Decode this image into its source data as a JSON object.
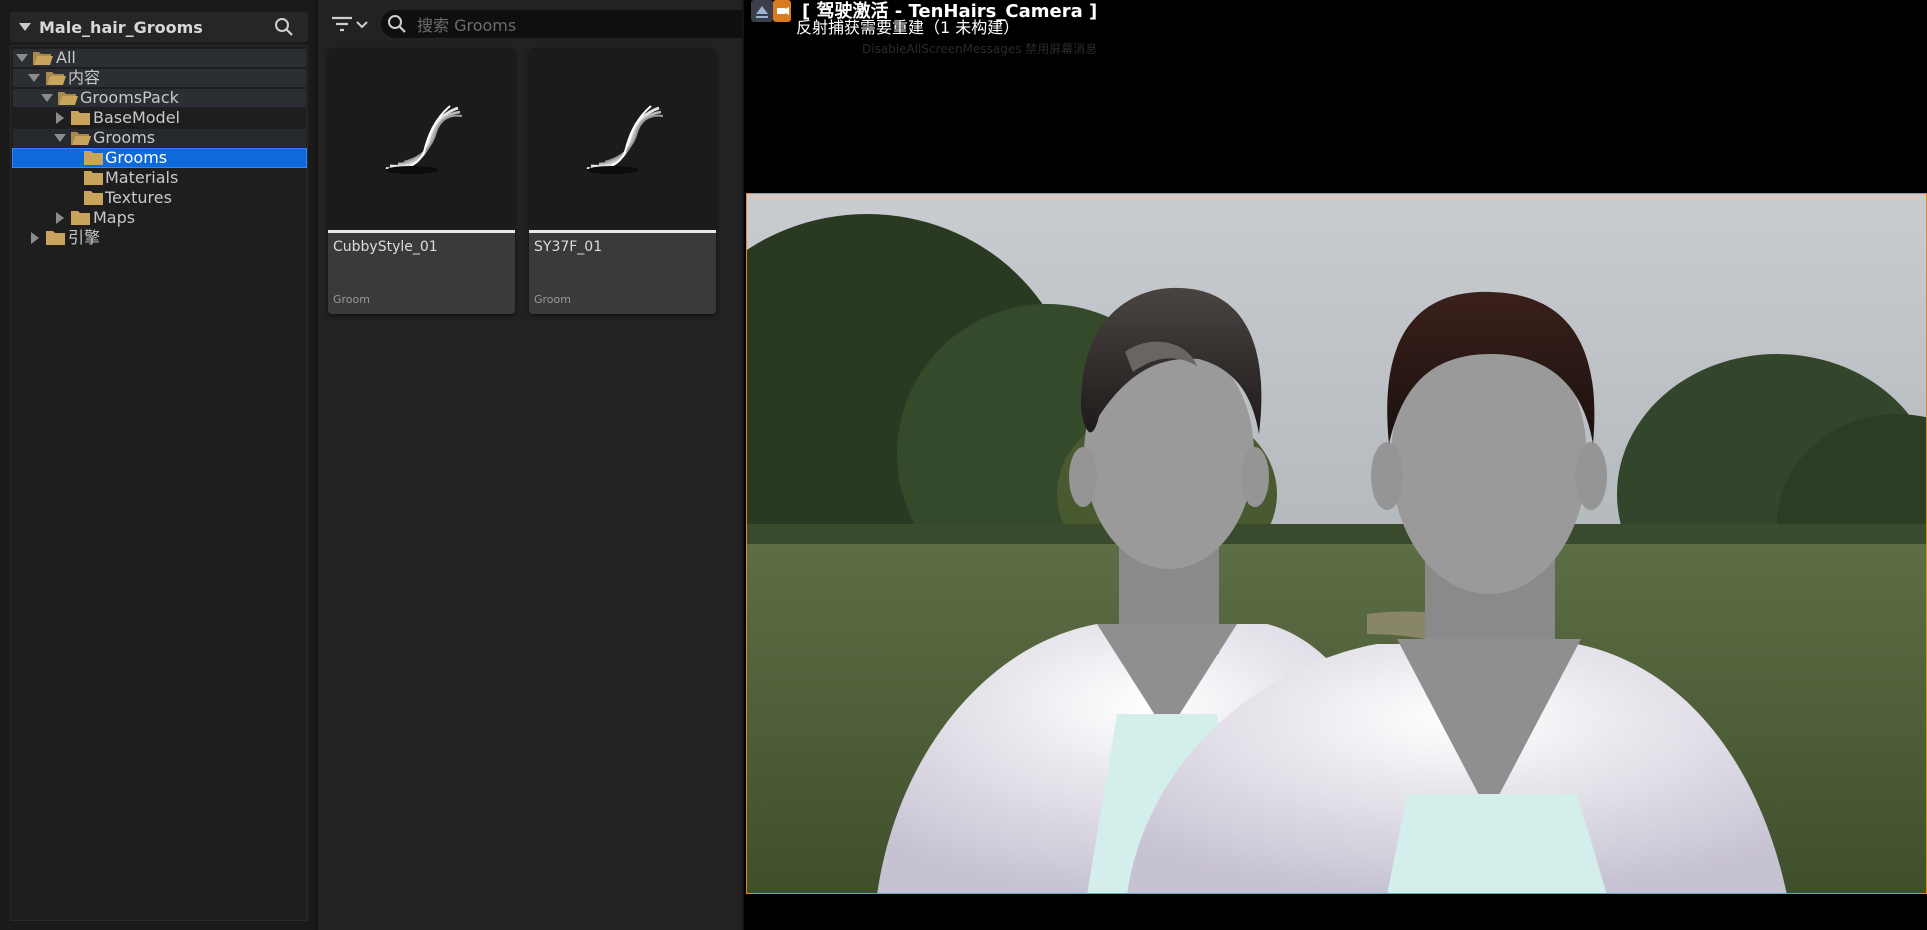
{
  "tree": {
    "panel_title": "Male_hair_Grooms",
    "items": [
      {
        "label": "All"
      },
      {
        "label": "内容"
      },
      {
        "label": "GroomsPack"
      },
      {
        "label": "BaseModel"
      },
      {
        "label": "Grooms"
      },
      {
        "label": "Grooms"
      },
      {
        "label": "Materials"
      },
      {
        "label": "Textures"
      },
      {
        "label": "Maps"
      },
      {
        "label": "引擎"
      }
    ]
  },
  "browser": {
    "search_placeholder": "搜索 Grooms",
    "assets": [
      {
        "name": "CubbyStyle_01",
        "type": "Groom"
      },
      {
        "name": "SY37F_01",
        "type": "Groom"
      }
    ]
  },
  "viewport": {
    "title": "[ 驾驶激活 - TenHairs_Camera ]",
    "warning": "反射捕获需要重建（1 未构建）",
    "faint_text": "DisableAllScreenMessages 禁用屏幕消息"
  },
  "colors": {
    "selection": "#0e6ad8",
    "folder": "#c9a45c",
    "viewport_border": "#e0892c"
  },
  "icons": {
    "collapse": "triangle-down-icon",
    "search": "magnifier-icon",
    "filter": "filter-icon",
    "folder": "folder-icon",
    "groom": "hair-strand-icon"
  }
}
